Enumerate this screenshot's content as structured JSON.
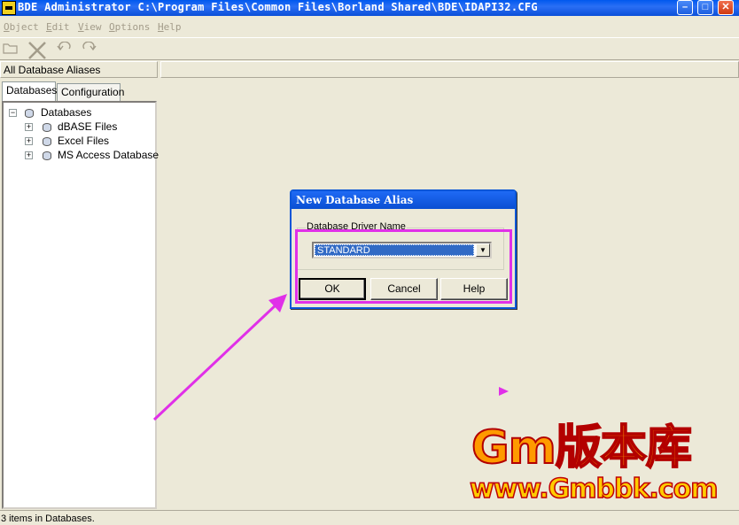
{
  "window": {
    "title": "BDE Administrator  C:\\Program Files\\Common Files\\Borland Shared\\BDE\\IDAPI32.CFG",
    "min_label": "–",
    "max_label": "□",
    "close_label": "✕"
  },
  "menu": [
    {
      "label": "Object"
    },
    {
      "label": "Edit"
    },
    {
      "label": "View"
    },
    {
      "label": "Options"
    },
    {
      "label": "Help"
    }
  ],
  "toolbar": {
    "icons": [
      "open-icon",
      "delete-icon",
      "undo-icon",
      "redo-icon"
    ],
    "disabled_color": "#a39c8a"
  },
  "left_panel": {
    "header": "All Database Aliases",
    "tabs": [
      {
        "label": "Databases"
      },
      {
        "label": "Configuration"
      }
    ],
    "tree": {
      "root": "Databases",
      "children": [
        {
          "label": "dBASE Files"
        },
        {
          "label": "Excel Files"
        },
        {
          "label": "MS Access Database"
        }
      ]
    }
  },
  "dialog": {
    "title": "New Database Alias",
    "group_label": "Database Driver Name",
    "driver_value": "STANDARD",
    "buttons": {
      "ok": "OK",
      "cancel": "Cancel",
      "help": "Help"
    }
  },
  "watermark": {
    "main": "Gm版本库",
    "url": "www.Gmbbk.com"
  },
  "status": {
    "text": "3 items in Databases."
  },
  "colors": {
    "titlebar": "#0058ee",
    "annotation": "#e030e8",
    "selection": "#316ac5"
  }
}
